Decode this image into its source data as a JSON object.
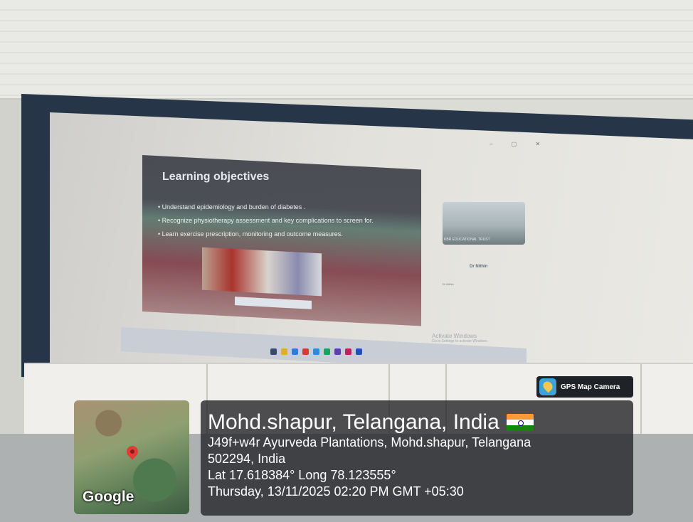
{
  "slide": {
    "title": "Learning objectives",
    "bullets": [
      "Understand epidemiology and burden of diabetes .",
      "Recognize physiotherapy assessment and key complications to screen for.",
      "Learn exercise prescription, monitoring and outcome measures."
    ]
  },
  "meeting_panel": {
    "video_caption": "KBR EDUCATIONAL TRUST",
    "participant_name": "Dr Nithin",
    "participant_sub": "Dr Nithin",
    "window_controls": "– ▢ ✕"
  },
  "activate_windows": {
    "title": "Activate Windows",
    "subtitle": "Go to Settings to activate Windows."
  },
  "overlay": {
    "badge_label": "GPS Map Camera",
    "map_logo": "Google",
    "location_title": "Mohd.shapur, Telangana, India",
    "address_line1": "J49f+w4r Ayurveda Plantations, Mohd.shapur, Telangana",
    "address_line2": "502294, India",
    "coordinates": "Lat 17.618384° Long 78.123555°",
    "datetime": "Thursday, 13/11/2025 02:20 PM GMT +05:30"
  },
  "colors": {
    "screen_frame": "#263548",
    "overlay_bg": "#28282c",
    "pin": "#e53935"
  },
  "icons": [
    "gps-camera-logo-icon",
    "map-pin-icon",
    "india-flag-icon"
  ]
}
